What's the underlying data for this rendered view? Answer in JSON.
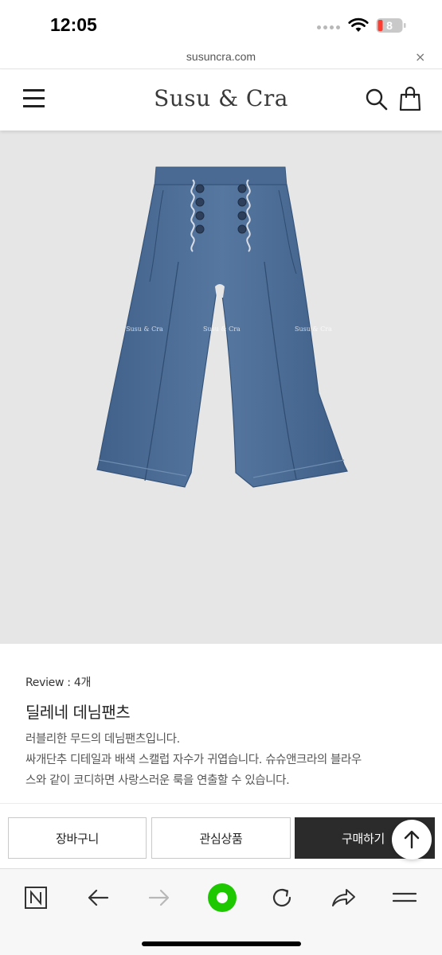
{
  "status_bar": {
    "time": "12:05",
    "battery_level": "8",
    "wifi_icon": "wifi-icon",
    "signal_icon": "signal-dots-icon"
  },
  "url_bar": {
    "url": "susuncra.com",
    "close_label": "×"
  },
  "header": {
    "logo": "Susu & Cra",
    "menu_icon": "hamburger-menu-icon",
    "search_icon": "search-icon",
    "cart_icon": "shopping-bag-icon"
  },
  "product": {
    "image_alt": "denim-pants-photo",
    "watermark": "Susu & Cra",
    "review": "Review : 4개",
    "title": "딜레네 데님팬츠",
    "description": [
      "러블리한 무드의 데님팬츠입니다.",
      "싸개단추 디테일과 배색 스캘럽 자수가 귀엽습니다. 슈슈앤크라의 블라우",
      "스와 같이 코디하면 사랑스러운 룩을 연출할 수 있습니다."
    ]
  },
  "actions": {
    "cart_label": "장바구니",
    "wish_label": "관심상품",
    "buy_label": "구매하기"
  },
  "toolbar": {
    "items": [
      "naver-n-icon",
      "back-arrow-icon",
      "forward-arrow-icon",
      "green-dot-icon",
      "reload-icon",
      "share-icon",
      "menu-lines-icon"
    ]
  },
  "colors": {
    "accent_green": "#1ec800",
    "buy_button": "#2b2b2b",
    "image_bg": "#e6e6e6",
    "denim": "#4f6f96"
  }
}
